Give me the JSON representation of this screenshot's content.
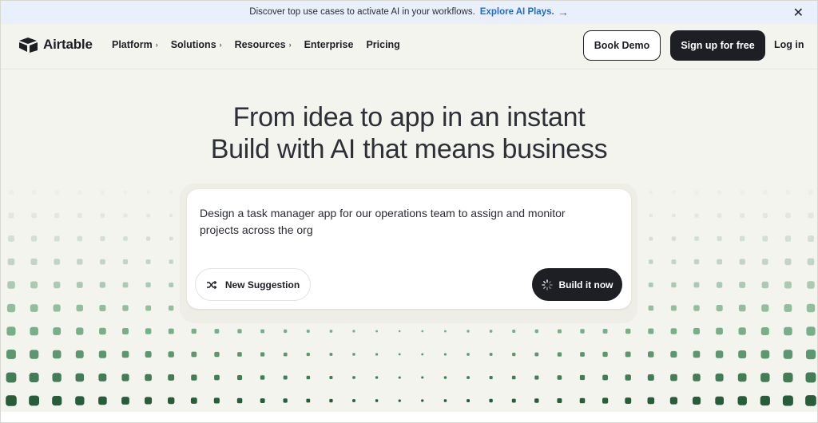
{
  "banner": {
    "text": "Discover top use cases to activate AI in your workflows.",
    "link": "Explore AI Plays.",
    "arrow": "→",
    "close": "✕"
  },
  "nav": {
    "logo": "Airtable",
    "items": [
      {
        "label": "Platform",
        "chevron": "›"
      },
      {
        "label": "Solutions",
        "chevron": "›"
      },
      {
        "label": "Resources",
        "chevron": "›"
      },
      {
        "label": "Enterprise",
        "chevron": ""
      },
      {
        "label": "Pricing",
        "chevron": ""
      }
    ],
    "book_demo": "Book Demo",
    "sign_up": "Sign up for free",
    "log_in": "Log in"
  },
  "hero": {
    "line1": "From idea to app in an instant",
    "line2": "Build with AI that means business"
  },
  "prompt_card": {
    "text": "Design a task manager app for our operations team to assign and monitor projects across the org",
    "new_suggestion": "New Suggestion",
    "build_now": "Build it now"
  },
  "colors": {
    "accent_green": "#2e6b45",
    "dark": "#1d1f25",
    "link_blue": "#1f6bd6"
  }
}
